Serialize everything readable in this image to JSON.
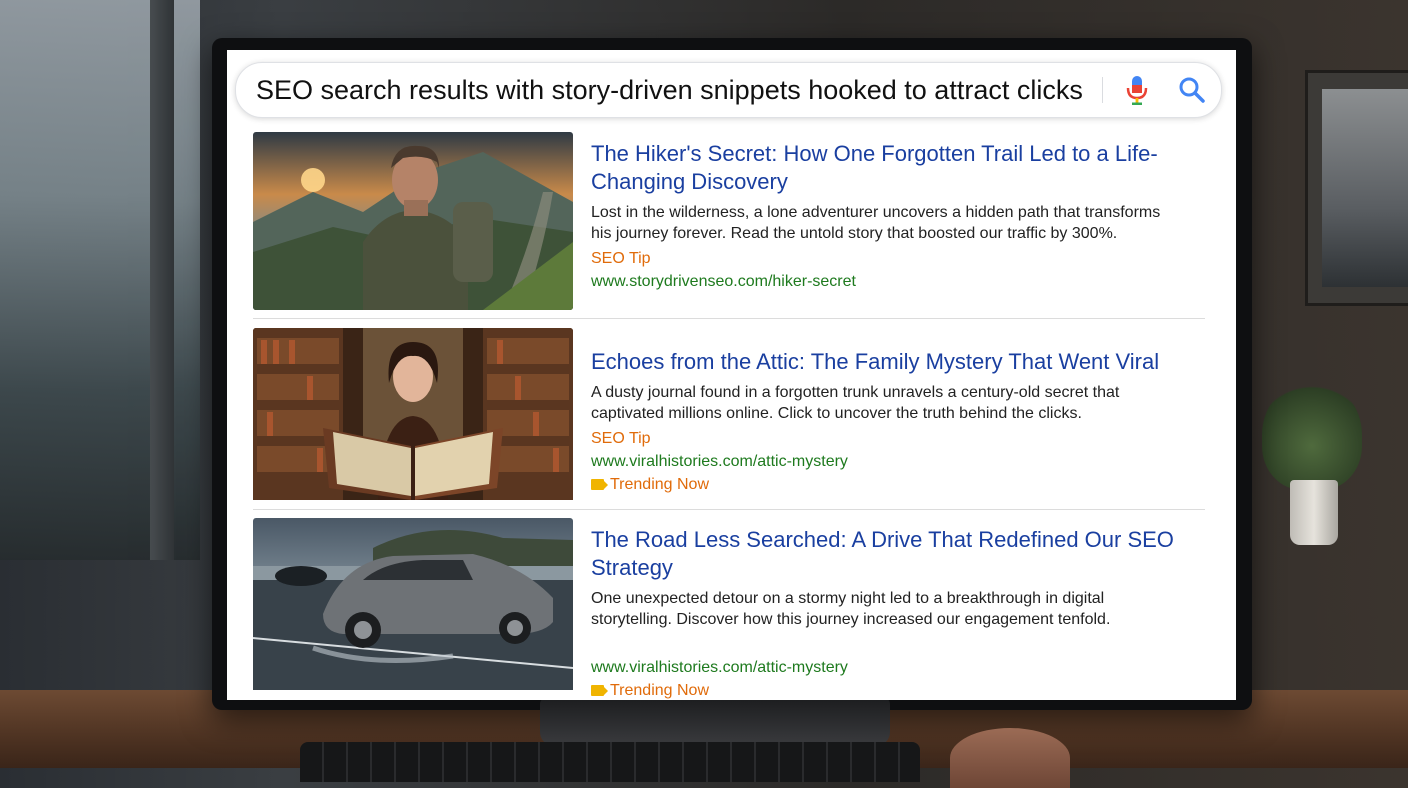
{
  "search": {
    "query": "SEO search results with story-driven snippets hooked to attract clicks"
  },
  "icons": {
    "mic": "microphone-icon",
    "search": "search-icon",
    "trending": "tag-icon"
  },
  "colors": {
    "title_link": "#1a3fa0",
    "url": "#1e7a1e",
    "tip": "#e06b0a",
    "mic_red": "#ea4335",
    "mic_blue": "#4285f4",
    "search_blue": "#4285f4"
  },
  "results": [
    {
      "title": "The Hiker's Secret: How One Forgotten Trail Led to a Life-Changing Discovery",
      "snippet": "Lost in the wilderness, a lone adventurer uncovers a hidden path that transforms his journey forever. Read the untold story that boosted our traffic by 300%.",
      "tip": "SEO Tip",
      "url": "www.storydrivenseo.com/hiker-secret",
      "trending": ""
    },
    {
      "title": "Echoes from the Attic: The Family Mystery That Went Viral",
      "snippet": "A dusty journal found in a forgotten trunk unravels a century-old secret that captivated millions online. Click to uncover the truth behind the clicks.",
      "tip": "SEO Tip",
      "url": "www.viralhistories.com/attic-mystery",
      "trending": "Trending Now"
    },
    {
      "title": "The Road Less Searched: A Drive That Redefined Our SEO Strategy",
      "snippet": "One unexpected detour on a stormy night led to a breakthrough in digital storytelling. Discover how this journey increased our engagement tenfold.",
      "tip": "",
      "url": "www.viralhistories.com/attic-mystery",
      "trending": "Trending Now"
    }
  ]
}
